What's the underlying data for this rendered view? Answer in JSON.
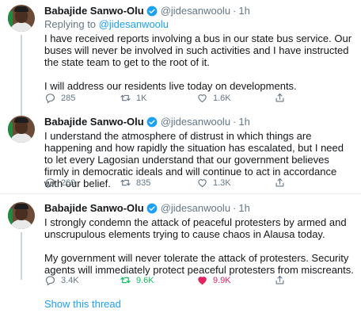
{
  "tweets": [
    {
      "name": "Babajide Sanwo-Olu",
      "handle": "@jidesanwoolu",
      "dot": "·",
      "time": "1h",
      "reply_prefix": "Replying to ",
      "reply_handle": "@jidesanwoolu",
      "paragraphs": [
        "I have received reports involving a bus in our state bus service. Our buses will never be involved in such activities and I have instructed the state team to get to the root of it.",
        "I will address our residents live today on developments."
      ],
      "replies": "285",
      "retweets": "1K",
      "likes": "1.6K",
      "retweet_active": false,
      "like_active": false
    },
    {
      "name": "Babajide Sanwo-Olu",
      "handle": "@jidesanwoolu",
      "dot": "·",
      "time": "1h",
      "paragraphs": [
        "I understand the atmosphere of distrust in which things are happening and how rapidly the situation has escalated, but I need to let every Lagosian understand that our government believes firmly in democratic ideals and will continue to act in accordance with our belief."
      ],
      "replies": "269",
      "retweets": "835",
      "likes": "1.3K",
      "retweet_active": false,
      "like_active": false
    },
    {
      "name": "Babajide Sanwo-Olu",
      "handle": "@jidesanwoolu",
      "dot": "·",
      "time": "1h",
      "paragraphs": [
        "I strongly condemn the attack of peaceful protesters by armed and unscrupulous elements trying to cause chaos in Alausa today.",
        "My government will never tolerate the attack of protesters. Security agents will immediately protect peaceful protesters from miscreants."
      ],
      "replies": "3.4K",
      "retweets": "9.6K",
      "likes": "9.9K",
      "retweet_active": true,
      "like_active": true
    }
  ],
  "show_thread": "Show this thread",
  "colors": {
    "accent": "#1da1f2",
    "retweet_active": "#17bf63",
    "like_active": "#e0245e",
    "muted": "#657786"
  },
  "icons": [
    "verified-badge-icon",
    "reply-icon",
    "retweet-icon",
    "like-icon",
    "share-icon"
  ]
}
